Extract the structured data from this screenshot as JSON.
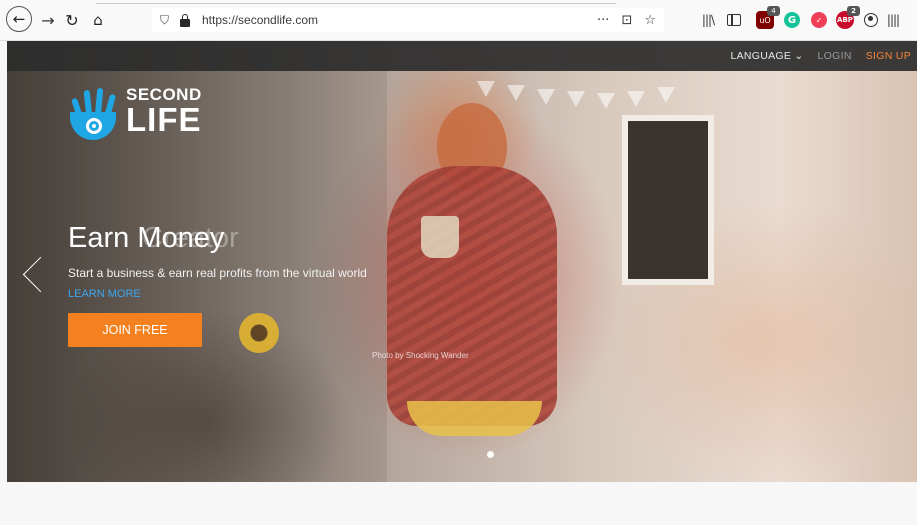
{
  "browser": {
    "url": "https://secondlife.com",
    "url_actions": [
      "···",
      "⊡",
      "☆"
    ],
    "nav_icons": [
      "back-arrow-icon",
      "forward-arrow-icon",
      "reload-icon",
      "home-icon"
    ],
    "toolbar_icons": [
      "library-icon",
      "sidebar-icon",
      "ublock-icon",
      "grammarly-icon",
      "pocket-icon",
      "adblock-plus-icon",
      "account-icon",
      "menu-icon"
    ],
    "ublock_badge": "4",
    "abp_badge": "2"
  },
  "site": {
    "nav": {
      "language": "LANGUAGE ⌄",
      "login": "LOGIN",
      "signup": "SIGN UP"
    },
    "logo": {
      "second": "SECOND",
      "life": "LIFE"
    },
    "slide": {
      "headline": "Earn Money",
      "headline_ghost": "Creator",
      "subtext": "Start a business & earn real profits from the virtual world",
      "learn_more": "LEARN MORE",
      "cta": "JOIN FREE",
      "credit": "Photo by Shocking Wander"
    },
    "carousel": {
      "slide_count_dots": 1,
      "current": 1
    }
  },
  "colors": {
    "accent_orange": "#f4811f",
    "link_blue": "#3da7ef",
    "logo_blue": "#1fa6e5",
    "header_bg": "#2d2d2d"
  }
}
